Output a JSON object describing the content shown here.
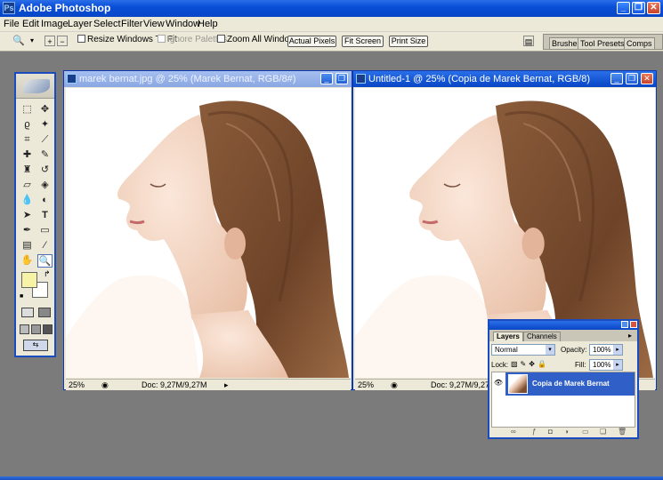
{
  "app": {
    "title": "Adobe Photoshop",
    "icon_label": "Ps"
  },
  "window_controls": {
    "minimize": "_",
    "restore": "❐",
    "close": "✕"
  },
  "menu": [
    "File",
    "Edit",
    "Image",
    "Layer",
    "Select",
    "Filter",
    "View",
    "Window",
    "Help"
  ],
  "options_bar": {
    "resize_windows": "Resize Windows To Fit",
    "ignore_palettes": "Ignore Palettes",
    "zoom_all": "Zoom All Windows",
    "actual_pixels": "Actual Pixels",
    "fit_screen": "Fit Screen",
    "print_size": "Print Size"
  },
  "palette_well": {
    "tabs": [
      "Brushes",
      "Tool Presets",
      "Comps"
    ]
  },
  "documents": [
    {
      "title": "marek bernat.jpg @ 25% (Marek Bernat, RGB/8#)",
      "zoom": "25%",
      "doc_info": "Doc: 9,27M/9,27M"
    },
    {
      "title": "Untitled-1 @ 25% (Copia de Marek Bernat, RGB/8)",
      "zoom": "25%",
      "doc_info": "Doc: 9,27M/9,27M"
    }
  ],
  "layers_panel": {
    "tabs": [
      "Layers",
      "Channels"
    ],
    "blend_mode": "Normal",
    "opacity_label": "Opacity:",
    "opacity_value": "100%",
    "lock_label": "Lock:",
    "fill_label": "Fill:",
    "fill_value": "100%",
    "layers": [
      {
        "name": "Copia de Marek Bernat",
        "visible": true
      }
    ]
  },
  "colors": {
    "foreground": "#f6f2a6",
    "background": "#ffffff",
    "accent": "#0846c6"
  }
}
